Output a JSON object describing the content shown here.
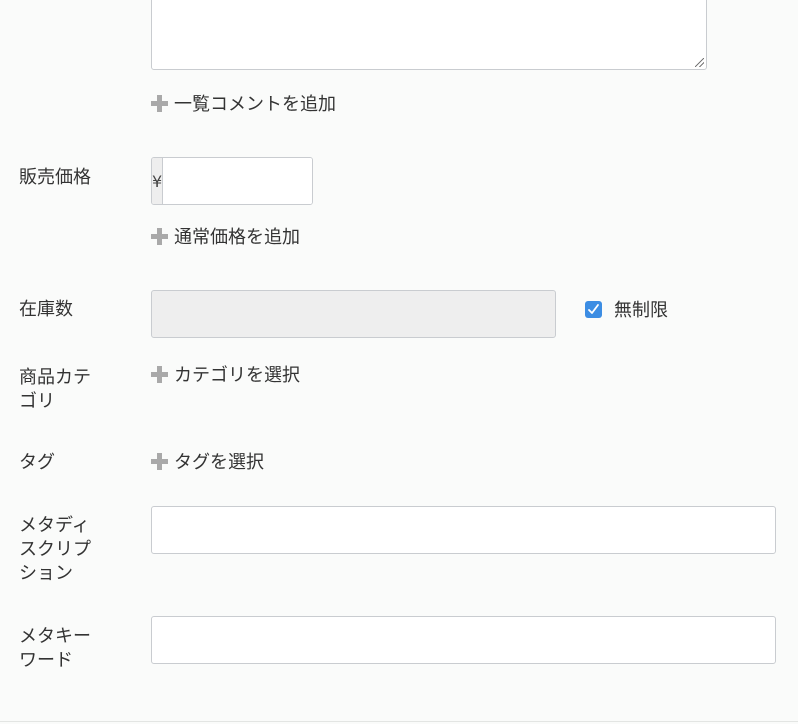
{
  "comment_section": {
    "add_list_comment": "一覧コメントを追加"
  },
  "price": {
    "label": "販売価格",
    "currency_symbol": "¥",
    "value": "",
    "add_regular_price": "通常価格を追加"
  },
  "stock": {
    "label": "在庫数",
    "value": "",
    "unlimited_label": "無制限",
    "unlimited_checked": true
  },
  "category": {
    "label_line1": "商品カテ",
    "label_line2": "ゴリ",
    "select_label": "カテゴリを選択"
  },
  "tags": {
    "label": "タグ",
    "select_label": "タグを選択"
  },
  "meta_description": {
    "label_line1": "メタディ",
    "label_line2": "スクリプ",
    "label_line3": "ション",
    "value": ""
  },
  "meta_keywords": {
    "label_line1": "メタキー",
    "label_line2": "ワード",
    "value": ""
  },
  "colors": {
    "accent": "#3c8de3",
    "plus_icon": "#a9a9a9",
    "border": "#c9ccd0",
    "disabled_bg": "#eeeeee"
  },
  "icons": {
    "plus": "plus-icon",
    "check": "check-icon",
    "resize": "resize-grip-icon"
  }
}
